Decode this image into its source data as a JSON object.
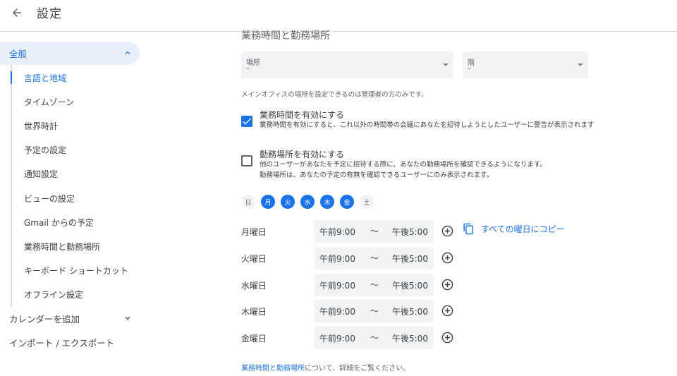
{
  "header": {
    "title": "設定"
  },
  "sidebar": {
    "general_label": "全般",
    "sub_items": [
      {
        "label": "言語と地域",
        "active": true
      },
      {
        "label": "タイムゾーン"
      },
      {
        "label": "世界時計"
      },
      {
        "label": "予定の設定"
      },
      {
        "label": "通知設定"
      },
      {
        "label": "ビューの設定"
      },
      {
        "label": "Gmail からの予定"
      },
      {
        "label": "業務時間と勤務場所"
      },
      {
        "label": "キーボード ショートカット"
      },
      {
        "label": "オフライン設定"
      }
    ],
    "add_calendar_label": "カレンダーを追加",
    "import_export_label": "インポート / エクスポート"
  },
  "main": {
    "section_title": "業務時間と勤務場所",
    "location_select": {
      "label": "場所",
      "value": "–"
    },
    "floor_select": {
      "label": "階",
      "value": "–"
    },
    "admin_note": "メインオフィスの場所を設定できるのは管理者の方のみです。",
    "working_hours": {
      "title": "業務時間を有効にする",
      "desc": "業務時間を有効にすると、これ以外の時間帯の会議にあなたを招待しようとしたユーザーに警告が表示されます",
      "checked": true
    },
    "working_location": {
      "title": "勤務場所を有効にする",
      "desc_line1": "他のユーザーがあなたを予定に招待する際に、あなたの勤務場所を確認できるようになります。",
      "desc_line2": "勤務場所は、あなたの予定の有無を確認できるユーザーにのみ表示されます。",
      "checked": false
    },
    "days": [
      {
        "label": "日",
        "on": false
      },
      {
        "label": "月",
        "on": true
      },
      {
        "label": "火",
        "on": true
      },
      {
        "label": "水",
        "on": true
      },
      {
        "label": "木",
        "on": true
      },
      {
        "label": "金",
        "on": true
      },
      {
        "label": "土",
        "on": false
      }
    ],
    "hours": [
      {
        "day": "月曜日",
        "start": "午前9:00",
        "sep": "〜",
        "end": "午後5:00"
      },
      {
        "day": "火曜日",
        "start": "午前9:00",
        "sep": "〜",
        "end": "午後5:00"
      },
      {
        "day": "水曜日",
        "start": "午前9:00",
        "sep": "〜",
        "end": "午後5:00"
      },
      {
        "day": "木曜日",
        "start": "午前9:00",
        "sep": "〜",
        "end": "午後5:00"
      },
      {
        "day": "金曜日",
        "start": "午前9:00",
        "sep": "〜",
        "end": "午後5:00"
      }
    ],
    "copy_label": "すべての曜日にコピー",
    "footer_link": "業務時間と勤務場所",
    "footer_rest": "について、詳細をご覧ください。"
  },
  "colors": {
    "accent": "#1a73e8",
    "accent_bg": "#e8f0fe",
    "field_bg": "#f1f3f4"
  }
}
